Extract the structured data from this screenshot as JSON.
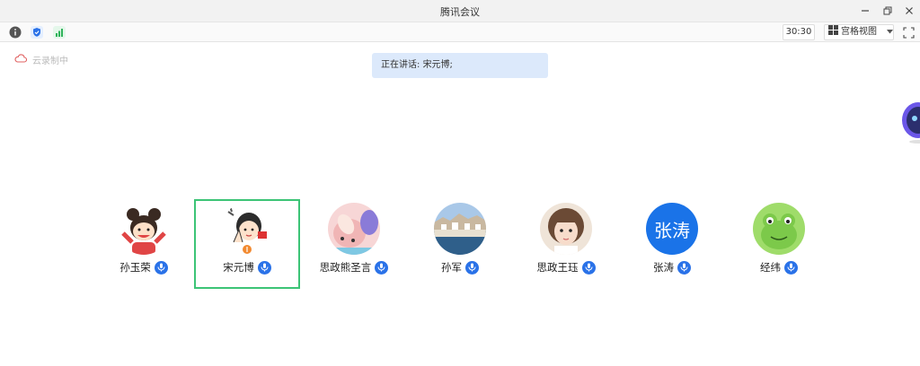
{
  "window": {
    "title": "腾讯会议",
    "controls": [
      "minimize-icon",
      "restore-icon",
      "close-icon"
    ]
  },
  "toolbar": {
    "left_icons": [
      "info-icon",
      "shield-icon",
      "signal-icon"
    ],
    "timer": "30:30",
    "view_mode_label": "宫格视图",
    "view_mode_icon": "grid-icon",
    "fullscreen_icon": "fullscreen-icon"
  },
  "recording": {
    "label": "云录制中",
    "icon": "cloud-icon"
  },
  "speaking_banner": {
    "prefix": "正在讲话:",
    "speaker": "宋元博;"
  },
  "participants": [
    {
      "name": "孙玉荣",
      "avatar": "cartoon-girl-avatar",
      "mic": "on"
    },
    {
      "name": "宋元博",
      "avatar": "cartoon-boy-avatar",
      "mic": "on",
      "active": true
    },
    {
      "name": "思政熊圣言",
      "avatar": "toy-avatar",
      "mic": "on"
    },
    {
      "name": "孙军",
      "avatar": "town-photo-avatar",
      "mic": "on"
    },
    {
      "name": "思政王珏",
      "avatar": "girl-photo-avatar",
      "mic": "on"
    },
    {
      "name": "张涛",
      "avatar_text": "张涛",
      "avatar_color": "#1a73e8",
      "mic": "on"
    },
    {
      "name": "经纬",
      "avatar": "frog-avatar",
      "mic": "on"
    }
  ],
  "colors": {
    "accent": "#2a72e8",
    "active_border": "#3cc476",
    "banner_bg": "#dce9fb"
  }
}
